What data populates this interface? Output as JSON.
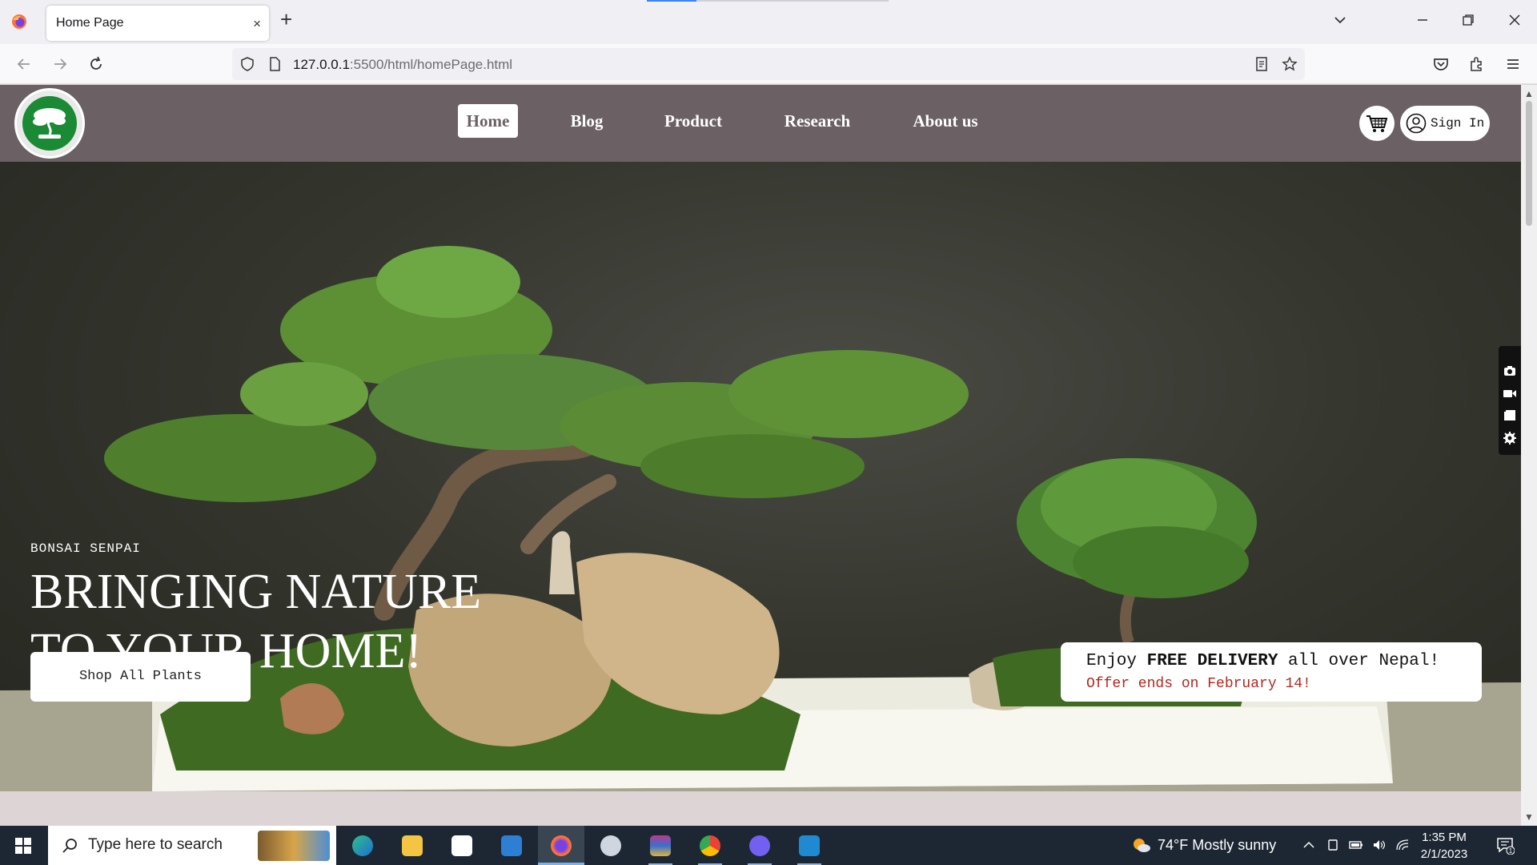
{
  "browser": {
    "tab_title": "Home Page",
    "tab_close": "×",
    "new_tab": "+",
    "url_host": "127.0.0.1",
    "url_rest": ":5500/html/homePage.html"
  },
  "site": {
    "nav": [
      "Home",
      "Blog",
      "Product",
      "Research",
      "About us"
    ],
    "active_nav": "Home",
    "signin_label": "Sign In",
    "hero": {
      "brand": "BONSAI SENPAI",
      "headline_line1": "BRINGING NATURE",
      "headline_line2": "TO YOUR HOME!",
      "cta": "Shop All Plants"
    },
    "promo": {
      "prefix": "Enjoy ",
      "highlight": "FREE DELIVERY",
      "suffix": " all over Nepal!",
      "subline": "Offer ends on February 14!"
    }
  },
  "taskbar": {
    "search_placeholder": "Type here to search",
    "weather": "74°F  Mostly sunny",
    "time": "1:35 PM",
    "date": "2/1/2023",
    "notification_count": "1"
  },
  "colors": {
    "header_bg": "#6b6063",
    "page_bg": "#ddd5d5",
    "logo_green": "#1a8a35",
    "promo_red": "#b3261e"
  }
}
